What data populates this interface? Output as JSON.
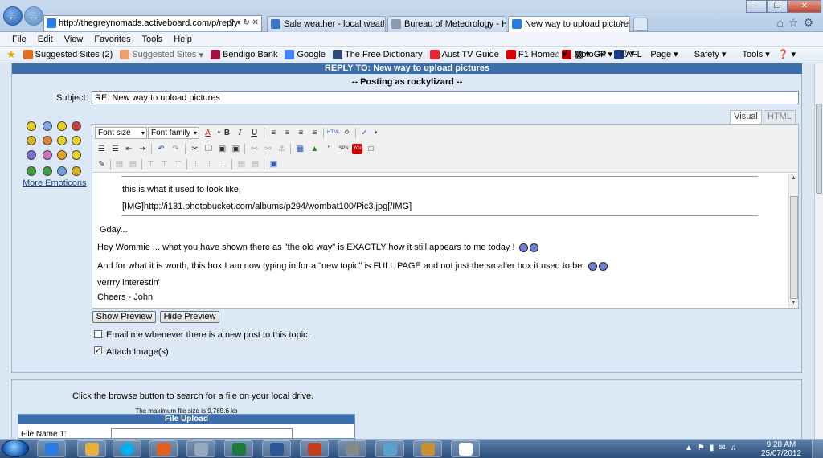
{
  "browser": {
    "address": "http://thegreynomads.activeboard.com/p/reply",
    "tabs": [
      {
        "label": "Sale weather - local weather fo..."
      },
      {
        "label": "Bureau of Meteorology - Hom..."
      },
      {
        "label": "New way to upload pictures..."
      }
    ],
    "menu": [
      "File",
      "Edit",
      "View",
      "Favorites",
      "Tools",
      "Help"
    ],
    "favorites": [
      "Suggested Sites (2)",
      "Suggested Sites",
      "Bendigo Bank",
      "Google",
      "The Free Dictionary",
      "Aust TV Guide",
      "F1 Home",
      "MotoGP",
      "AFL"
    ],
    "commands": [
      "Page",
      "Safety",
      "Tools"
    ]
  },
  "form": {
    "header": "REPLY TO: New way to upload pictures",
    "posting_as": "-- Posting as rockylizard --",
    "subject_label": "Subject:",
    "subject_value": "RE: New way to upload pictures",
    "tab_visual": "Visual",
    "tab_html": "HTML",
    "more_emoticons": "More Emoticons",
    "font_size": "Font size",
    "font_family": "Font family",
    "content": {
      "quote_line1": "this is what it used to look like,",
      "quote_line2": "[IMG]http://i131.photobucket.com/albums/p294/wombat100/Pic3.jpg[/IMG]",
      "line1": "Gday...",
      "line2": "Hey Wommie ... what you have shown there as \"the old way\" is EXACTLY how it still appears to me today !",
      "line3": "And for what it is worth, this box I am now typing in for a \"new topic\" is FULL PAGE and not just the smaller box it used to be.",
      "line4": "verrry interestin'",
      "line5": "Cheers - John"
    },
    "show_preview": "Show Preview",
    "hide_preview": "Hide Preview",
    "email_label": "Email me whenever there is a new post to this topic.",
    "email_checked": false,
    "attach_label": "Attach Image(s)",
    "attach_checked": true
  },
  "upload": {
    "tip": "Click the browse button to search for a file on your local drive.",
    "max": "The maximum file size is 9,765.6 kb",
    "title": "File Upload",
    "file_label": "File Name 1:"
  },
  "taskbar": {
    "time": "9:28 AM",
    "date": "25/07/2012"
  },
  "colors": {
    "header_blue": "#3e6fad",
    "panel_bg": "#dce8f5"
  }
}
